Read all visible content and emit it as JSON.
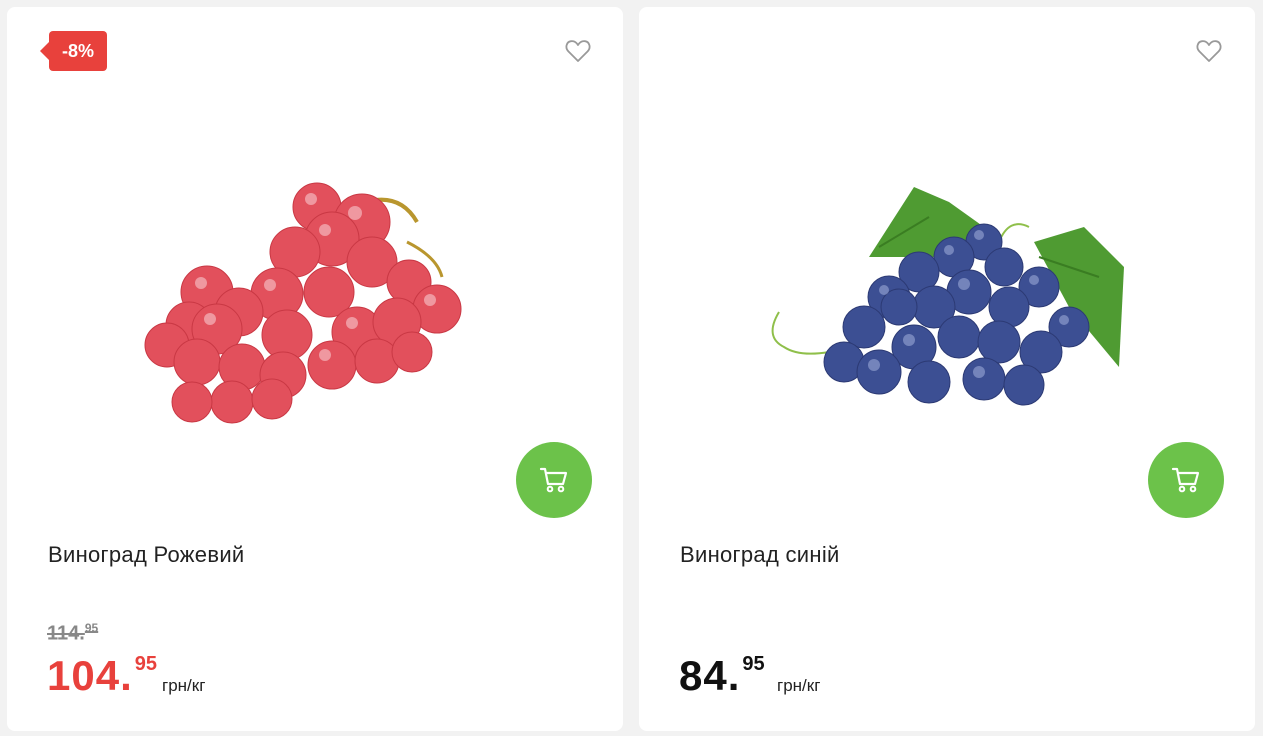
{
  "products": [
    {
      "badge": "-8%",
      "name": "Виноград Рожевий",
      "old_price_int": "114.",
      "old_price_cents": "95",
      "price_int": "104.",
      "price_cents": "95",
      "unit": "грн/кг",
      "fav_icon": "heart-outline-icon",
      "cart_icon": "cart-icon",
      "image": "red-grapes-image"
    },
    {
      "name": "Виноград синій",
      "price_int": "84.",
      "price_cents": "95",
      "unit": "грн/кг",
      "fav_icon": "heart-outline-icon",
      "cart_icon": "cart-icon",
      "image": "blue-grapes-image"
    }
  ],
  "colors": {
    "sale": "#e8413c",
    "cart_button": "#6cc24a",
    "text": "#222222",
    "muted": "#888888",
    "page_bg": "#f2f2f2"
  }
}
